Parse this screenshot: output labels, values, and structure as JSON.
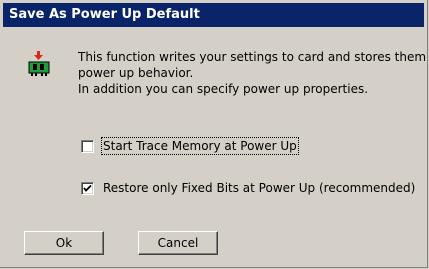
{
  "dialog": {
    "title": "Save As Power Up Default"
  },
  "icon": {
    "name": "card-download-icon"
  },
  "message": {
    "line1": "This function writes your settings to card and stores them",
    "line2": "power up behavior.",
    "line3": "In addition you can specify power up properties."
  },
  "options": [
    {
      "label": "Start Trace Memory at Power Up",
      "checked": false
    },
    {
      "label": "Restore only Fixed Bits at Power Up (recommended)",
      "checked": true
    }
  ],
  "buttons": {
    "ok": "Ok",
    "cancel": "Cancel"
  },
  "colors": {
    "titlebar": "#0a246a",
    "face": "#d4d0c8",
    "icon_green": "#1f9e3a",
    "icon_red": "#d42a1c"
  }
}
